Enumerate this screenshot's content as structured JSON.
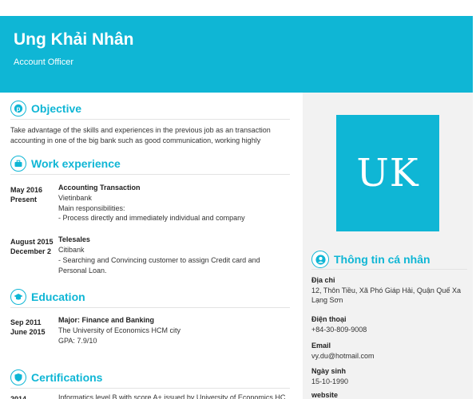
{
  "header": {
    "name": "Ung Khải Nhân",
    "role": "Account Officer"
  },
  "avatar": {
    "initials": "UK"
  },
  "objective": {
    "title": "Objective",
    "text_line1": "Take advantage of the skills and experiences in the previous job as an transaction",
    "text_line2": "accounting in one of the big bank such as good communication, working highly"
  },
  "work": {
    "title": "Work experience",
    "items": [
      {
        "date_line1": "May 2016",
        "date_line2": "Present",
        "position": "Accounting Transaction",
        "company": "Vietinbank",
        "desc_line1": "Main responsibilities:",
        "desc_line2": "- Process directly and immediately individual and company"
      },
      {
        "date_line1": "August 2015",
        "date_line2": "December 2",
        "position": "Telesales",
        "company": "Citibank",
        "desc_line1": "- Searching and Convincing customer to assign Credit card and",
        "desc_line2": "Personal Loan."
      }
    ]
  },
  "education": {
    "title": "Education",
    "date_line1": "Sep 2011",
    "date_line2": "June 2015",
    "major": "Major: Finance and Banking",
    "school": "The University of Economics HCM city",
    "gpa": "GPA: 7.9/10"
  },
  "certifications": {
    "title": "Certifications",
    "date": "2014",
    "text": "Informatics level B with score A+ issued by University of Economics HC"
  },
  "personal": {
    "title": "Thông tin cá nhân",
    "address_label": "Địa chỉ",
    "address_line1": "12, Thôn Tiều, Xã Phó Giáp Hải, Quận Quế Xa",
    "address_line2": "Lạng Sơn",
    "phone_label": "Điện thoại",
    "phone": "+84-30-809-9008",
    "email_label": "Email",
    "email": "vy.du@hotmail.com",
    "dob_label": "Ngày sinh",
    "dob": "15-10-1990",
    "website_label": "website"
  },
  "colors": {
    "accent": "#0fb6d5",
    "sidebar": "#f2f2f2"
  }
}
